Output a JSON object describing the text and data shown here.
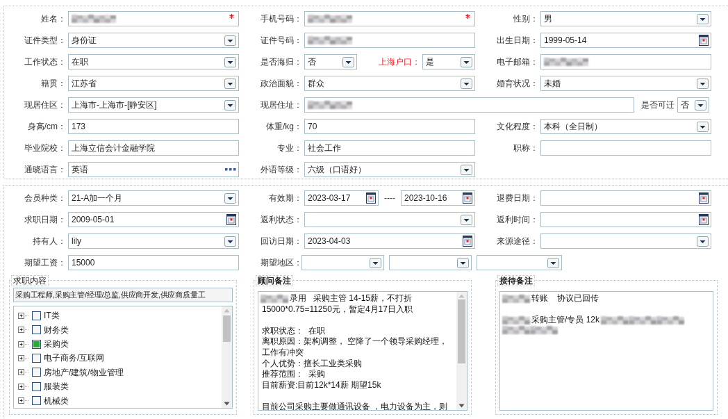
{
  "profile": {
    "rows": [
      [
        {
          "kind": "single",
          "label": "姓名：",
          "field": {
            "kind": "text",
            "required": true,
            "blurred": true
          }
        },
        {
          "kind": "single",
          "label": "手机号码：",
          "field": {
            "kind": "text",
            "required": true,
            "blurred": true
          }
        },
        {
          "kind": "single",
          "label": "性别：",
          "field": {
            "kind": "select",
            "value": "男"
          }
        }
      ],
      [
        {
          "kind": "single",
          "label": "证件类型：",
          "field": {
            "kind": "select",
            "value": "身份证"
          }
        },
        {
          "kind": "single",
          "label": "证件号码：",
          "field": {
            "kind": "text",
            "blurred": true
          }
        },
        {
          "kind": "single",
          "label": "出生日期：",
          "field": {
            "kind": "date",
            "value": "1999-05-14"
          }
        }
      ],
      [
        {
          "kind": "single",
          "label": "工作状态：",
          "field": {
            "kind": "select",
            "value": "在职"
          }
        },
        {
          "kind": "pair",
          "label": "是否海归：",
          "fields": [
            {
              "kind": "select",
              "value": "否"
            },
            {
              "kind": "select",
              "label": "上海户口：",
              "highlight": true,
              "value": "是"
            }
          ]
        },
        {
          "kind": "single",
          "label": "电子邮箱：",
          "field": {
            "kind": "text",
            "blurred": true
          }
        }
      ],
      [
        {
          "kind": "single",
          "label": "籍贯：",
          "field": {
            "kind": "select",
            "value": "江苏省"
          }
        },
        {
          "kind": "single",
          "label": "政治面貌：",
          "field": {
            "kind": "select",
            "value": "群众"
          }
        },
        {
          "kind": "single",
          "label": "婚育状况：",
          "field": {
            "kind": "select",
            "value": "未婚"
          }
        }
      ],
      [
        {
          "kind": "single",
          "label": "现居住区：",
          "field": {
            "kind": "select",
            "value": "上海市-上海市-[静安区]"
          }
        },
        {
          "kind": "wide",
          "label": "现居住址：",
          "fields": [
            {
              "kind": "text",
              "blurred": true
            },
            {
              "kind": "select",
              "label": "是否可迁",
              "highlight": false,
              "value": "否"
            }
          ]
        }
      ],
      [
        {
          "kind": "single",
          "label": "身高/cm：",
          "field": {
            "kind": "text",
            "value": "173"
          }
        },
        {
          "kind": "single",
          "label": "体重/kg：",
          "field": {
            "kind": "text",
            "value": "70"
          }
        },
        {
          "kind": "single",
          "label": "文化程度：",
          "field": {
            "kind": "select",
            "value": "本科（全日制）"
          }
        }
      ],
      [
        {
          "kind": "single",
          "label": "毕业院校：",
          "field": {
            "kind": "text",
            "value": "上海立信会计金融学院"
          }
        },
        {
          "kind": "single",
          "label": "专业：",
          "field": {
            "kind": "text",
            "value": "社会工作"
          }
        },
        {
          "kind": "single",
          "label": "职称：",
          "field": {
            "kind": "text"
          }
        }
      ],
      [
        {
          "kind": "single",
          "label": "通晓语言：",
          "field": {
            "kind": "lookup",
            "value": "英语"
          }
        },
        {
          "kind": "single",
          "label": "外语等级：",
          "field": {
            "kind": "select",
            "value": "六级（口语好）"
          }
        }
      ]
    ]
  },
  "membership": {
    "rows": [
      [
        {
          "kind": "single",
          "label": "会员种类：",
          "field": {
            "kind": "select",
            "value": "21-A加一个月"
          }
        },
        {
          "kind": "range",
          "label": "有效期：",
          "fields": [
            {
              "kind": "date",
              "value": "2023-03-17"
            },
            {
              "kind": "separator",
              "value": "----"
            },
            {
              "kind": "date",
              "value": "2023-10-16"
            }
          ]
        },
        {
          "kind": "single",
          "label": "退费日期：",
          "field": {
            "kind": "date"
          }
        }
      ],
      [
        {
          "kind": "single",
          "label": "求职日期：",
          "field": {
            "kind": "date",
            "value": "2009-05-01"
          }
        },
        {
          "kind": "single",
          "label": "返利状态：",
          "field": {
            "kind": "select"
          }
        },
        {
          "kind": "single",
          "label": "返利时间：",
          "field": {
            "kind": "date"
          }
        }
      ],
      [
        {
          "kind": "single",
          "label": "持有人：",
          "field": {
            "kind": "select",
            "value": "lily"
          }
        },
        {
          "kind": "single",
          "label": "回访日期：",
          "field": {
            "kind": "date",
            "value": "2023-04-03"
          }
        },
        {
          "kind": "single",
          "label": "来源途径：",
          "field": {
            "kind": "select"
          }
        }
      ],
      [
        {
          "kind": "single",
          "label": "期望工资：",
          "field": {
            "kind": "text",
            "value": "15000"
          }
        },
        {
          "kind": "triple",
          "label": "期望地区：",
          "fields": [
            {
              "kind": "select"
            },
            {
              "kind": "select"
            },
            {
              "kind": "select"
            }
          ]
        }
      ]
    ]
  },
  "job_content": {
    "legend": "求职内容",
    "summary": "采购工程师,采购主管/经理/总监,供应商开发,供应商质量工",
    "tree": [
      {
        "label": "IT类",
        "checked": false,
        "expanded": false
      },
      {
        "label": "财务类",
        "checked": false,
        "expanded": false
      },
      {
        "label": "采购类",
        "checked": true,
        "expanded": false
      },
      {
        "label": "电子商务/互联网",
        "checked": false,
        "expanded": false
      },
      {
        "label": "房地产/建筑/物业管理",
        "checked": false,
        "expanded": false
      },
      {
        "label": "服装类",
        "checked": false,
        "expanded": false
      },
      {
        "label": "机械类",
        "checked": false,
        "expanded": false
      }
    ]
  },
  "consultant_notes": {
    "legend": "顾问备注",
    "lines": [
      {
        "segments": [
          {
            "kind": "blur"
          },
          {
            "kind": "text",
            "text": "录用   采购主管 14-15薪，不打折"
          }
        ]
      },
      {
        "segments": [
          {
            "kind": "text",
            "text": "15000*0.75=11250元，暂定4月17日入职"
          }
        ]
      },
      {
        "space_before": true,
        "segments": [
          {
            "kind": "text",
            "text": "求职状态：  在职"
          }
        ]
      },
      {
        "segments": [
          {
            "kind": "text",
            "text": "离职原因：架构调整， 空降了一个领导采购经理，"
          }
        ]
      },
      {
        "segments": [
          {
            "kind": "text",
            "text": "工作有冲突"
          }
        ]
      },
      {
        "segments": [
          {
            "kind": "text",
            "text": "个人优势：擅长工业类采购"
          }
        ]
      },
      {
        "segments": [
          {
            "kind": "text",
            "text": "推荐范围：  采购"
          }
        ]
      },
      {
        "segments": [
          {
            "kind": "text",
            "text": "目前薪资:目前12k*14薪 期望15k"
          }
        ]
      },
      {
        "space_before": true,
        "segments": [
          {
            "kind": "text",
            "text": "目前公司采购主要做通讯设备 ，电力设备为主，则"
          }
        ]
      }
    ]
  },
  "reception_notes": {
    "legend": "接待备注",
    "lines": [
      {
        "segments": [
          {
            "kind": "blur"
          },
          {
            "kind": "text",
            "text": "转账    协议已回传"
          }
        ]
      },
      {
        "space_before": true,
        "segments": [
          {
            "kind": "blur"
          },
          {
            "kind": "text",
            "text": "采购主管/专员 12k"
          },
          {
            "kind": "blur"
          },
          {
            "kind": "blur"
          },
          {
            "kind": "blur"
          }
        ]
      },
      {
        "segments": [
          {
            "kind": "blur"
          },
          {
            "kind": "blur"
          }
        ]
      }
    ]
  }
}
